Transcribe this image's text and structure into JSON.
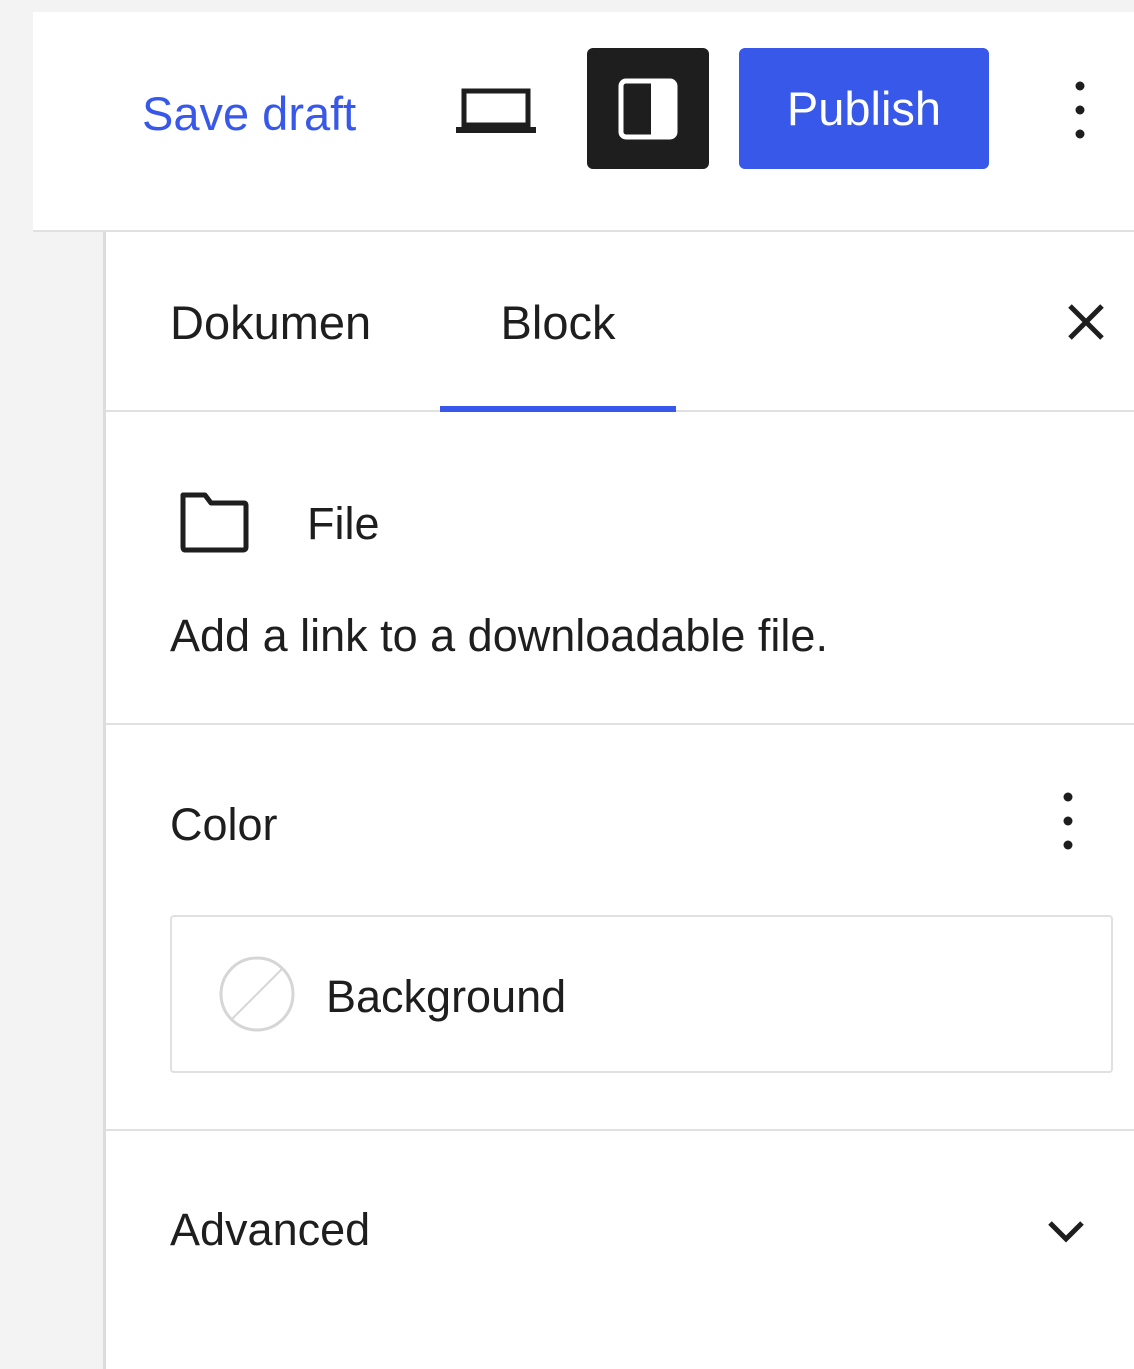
{
  "header": {
    "save_draft_label": "Save draft",
    "publish_label": "Publish",
    "preview_icon": "laptop-icon",
    "settings_icon": "sidebar-panel-icon",
    "options_icon": "more-vertical-icon"
  },
  "sidebar": {
    "tabs": [
      {
        "label": "Dokumen",
        "active": false
      },
      {
        "label": "Block",
        "active": true
      }
    ],
    "close_icon": "close-icon",
    "block_card": {
      "icon": "folder-icon",
      "title": "File",
      "description": "Add a link to a downloadable file."
    },
    "color_panel": {
      "title": "Color",
      "options_icon": "more-vertical-icon",
      "items": [
        {
          "label": "Background",
          "swatch_icon": "no-color-swatch-icon"
        }
      ]
    },
    "advanced_panel": {
      "title": "Advanced",
      "toggle_icon": "chevron-down-icon"
    }
  },
  "colors": {
    "accent": "#3858e9",
    "dark": "#1e1e1e",
    "border": "#e0e0e0",
    "background": "#f3f3f3"
  }
}
